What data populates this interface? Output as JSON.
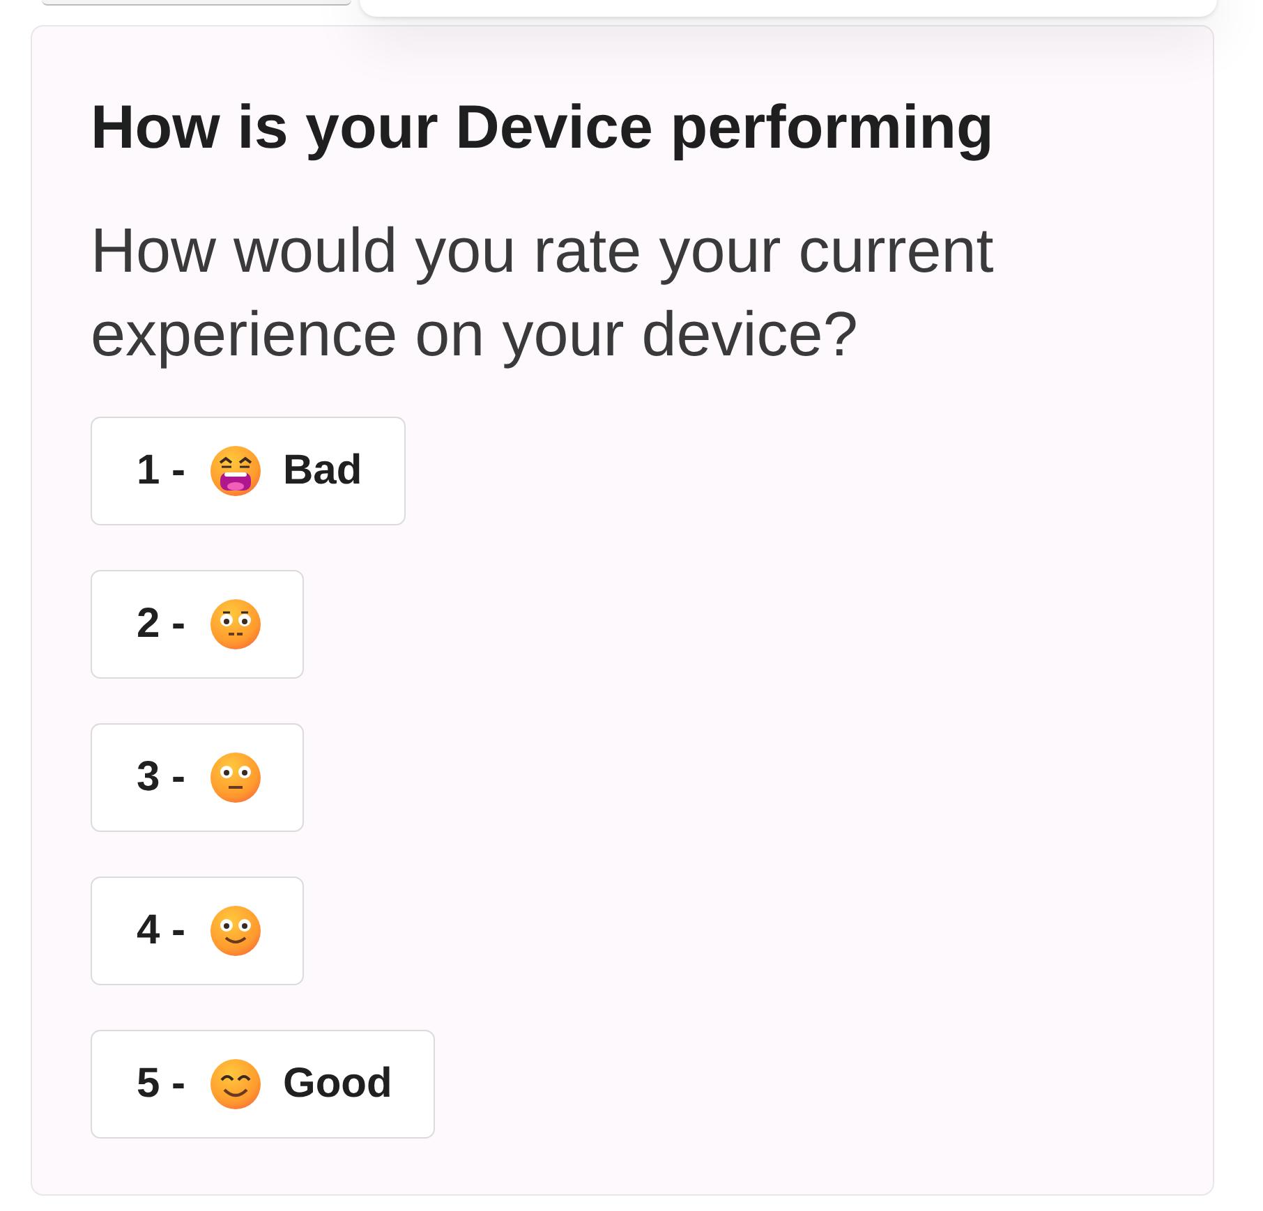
{
  "survey": {
    "title": "How is your Device performing",
    "question": "How would you rate your current experience on your device?",
    "options": [
      {
        "prefix": "1 -",
        "label": "Bad"
      },
      {
        "prefix": "2 -"
      },
      {
        "prefix": "3 -"
      },
      {
        "prefix": "4 -"
      },
      {
        "prefix": "5 -",
        "label": "Good"
      }
    ]
  }
}
